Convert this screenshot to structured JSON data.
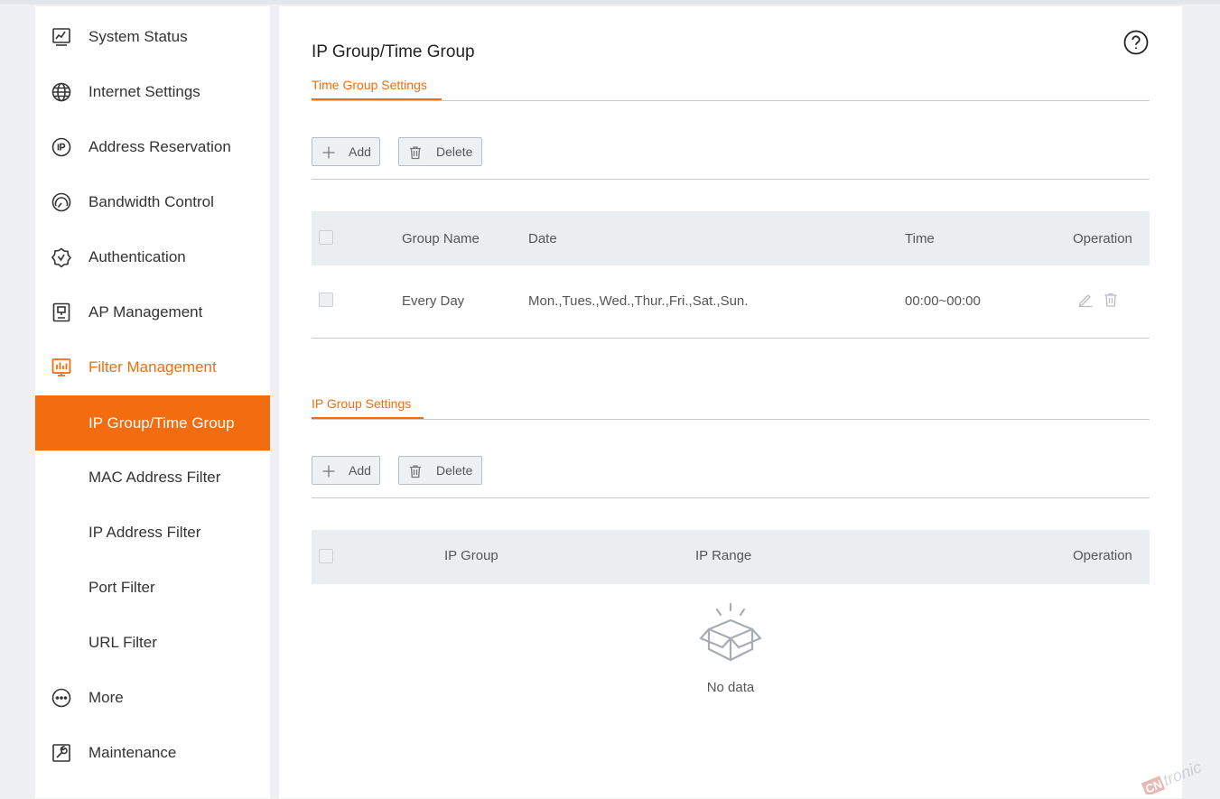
{
  "sidebar": {
    "items": [
      {
        "label": "System Status",
        "icon": "status-monitor-icon"
      },
      {
        "label": "Internet Settings",
        "icon": "globe-icon"
      },
      {
        "label": "Address Reservation",
        "icon": "ip-badge-icon"
      },
      {
        "label": "Bandwidth Control",
        "icon": "speedometer-icon"
      },
      {
        "label": "Authentication",
        "icon": "shield-check-icon"
      },
      {
        "label": "AP Management",
        "icon": "access-point-icon"
      },
      {
        "label": "Filter Management",
        "icon": "filter-chart-icon"
      },
      {
        "label": "IP Group/Time Group"
      },
      {
        "label": "MAC Address Filter"
      },
      {
        "label": "IP Address Filter"
      },
      {
        "label": "Port Filter"
      },
      {
        "label": "URL Filter"
      },
      {
        "label": "More",
        "icon": "more-dots-icon"
      },
      {
        "label": "Maintenance",
        "icon": "wrench-icon"
      }
    ]
  },
  "main": {
    "title": "IP Group/Time Group",
    "time_group": {
      "tab_label": "Time Group Settings",
      "add_label": "Add",
      "delete_label": "Delete",
      "columns": {
        "group_name": "Group Name",
        "date": "Date",
        "time": "Time",
        "operation": "Operation"
      },
      "rows": [
        {
          "group_name": "Every Day",
          "date": "Mon.,Tues.,Wed.,Thur.,Fri.,Sat.,Sun.",
          "time": "00:00~00:00"
        }
      ]
    },
    "ip_group": {
      "tab_label": "IP Group Settings",
      "add_label": "Add",
      "delete_label": "Delete",
      "columns": {
        "ip_group": "IP Group",
        "ip_range": "IP Range",
        "operation": "Operation"
      },
      "empty_text": "No data"
    }
  },
  "colors": {
    "accent": "#f36d10",
    "header_bg": "#ebeef1",
    "page_bg": "#eef0f3"
  }
}
